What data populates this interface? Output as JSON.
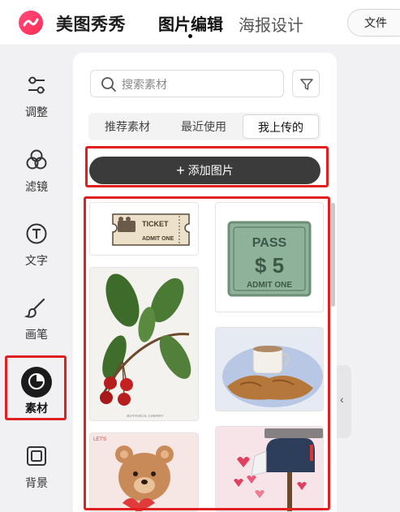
{
  "app": {
    "brand": "美图秀秀",
    "nav_edit": "图片编辑",
    "nav_poster": "海报设计",
    "file_button": "文件",
    "logo_icon": "meitu-logo-icon"
  },
  "sidebar": {
    "items": [
      {
        "label": "调整",
        "icon": "sliders-icon"
      },
      {
        "label": "滤镜",
        "icon": "filter-circles-icon"
      },
      {
        "label": "文字",
        "icon": "text-icon"
      },
      {
        "label": "画笔",
        "icon": "brush-icon"
      },
      {
        "label": "素材",
        "icon": "sticker-icon",
        "active": true
      },
      {
        "label": "背景",
        "icon": "background-icon"
      }
    ]
  },
  "panel": {
    "search_placeholder": "搜索素材",
    "tabs": [
      "推荐素材",
      "最近使用",
      "我上传的"
    ],
    "active_tab": "我上传的",
    "add_button": "添加图片",
    "thumbnails": {
      "ticket": {
        "line1": "TICKET",
        "line2": "ADMIT ONE"
      },
      "pass": {
        "line1": "PASS",
        "line2": "$ 5",
        "line3": "ADMIT ONE"
      },
      "cherries": {
        "caption": "BOTANICAL CHERRY"
      },
      "bear": {
        "tag": "LET'S"
      }
    }
  },
  "colors": {
    "highlight": "#e02020",
    "add_button_bg": "#3b3b3b",
    "pass_green": "#8fb29a"
  }
}
